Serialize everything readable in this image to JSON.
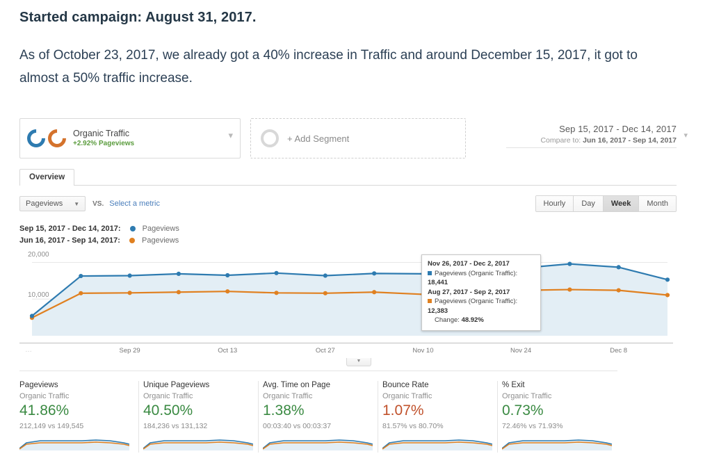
{
  "article": {
    "heading": "Started campaign: August 31, 2017.",
    "body": "As of October 23, 2017, we already got a 40% increase in Traffic and around December 15, 2017, it got to almost a 50% traffic increase."
  },
  "segment": {
    "name": "Organic Traffic",
    "delta": "+2.92% Pageviews",
    "caret": "chevron-down-icon",
    "add_label": "+ Add Segment"
  },
  "date_picker": {
    "range": "Sep 15, 2017 - Dec 14, 2017",
    "compare_prefix": "Compare to:",
    "compare_range": "Jun 16, 2017 - Sep 14, 2017"
  },
  "tabs": [
    {
      "label": "Overview",
      "active": true
    }
  ],
  "metric_bar": {
    "selected_metric": "Pageviews",
    "vs_label": "VS.",
    "select_metric_link": "Select a metric",
    "granularity": [
      {
        "label": "Hourly",
        "active": false
      },
      {
        "label": "Day",
        "active": false
      },
      {
        "label": "Week",
        "active": true
      },
      {
        "label": "Month",
        "active": false
      }
    ]
  },
  "legend": [
    {
      "range": "Sep 15, 2017 - Dec 14, 2017:",
      "series": "Pageviews",
      "color": "#2e7bb0"
    },
    {
      "range": "Jun 16, 2017 - Sep 14, 2017:",
      "series": "Pageviews",
      "color": "#e08020"
    }
  ],
  "tooltip": {
    "period1_range": "Nov 26, 2017 - Dec 2, 2017",
    "period1_metric": "Pageviews (Organic Traffic):",
    "period1_value": "18,441",
    "period2_range": "Aug 27, 2017 - Sep 2, 2017",
    "period2_metric": "Pageviews (Organic Traffic):",
    "period2_value": "12,383",
    "change_label": "Change:",
    "change_value": "48.92%"
  },
  "chart_data": {
    "type": "line",
    "title": "Pageviews (Organic Traffic)",
    "xlabel": "",
    "ylabel": "Pageviews",
    "ylim": [
      0,
      22000
    ],
    "yticks": [
      10000,
      20000
    ],
    "ytick_labels": [
      "10,000",
      "20,000"
    ],
    "grid": true,
    "legend_position": "above-left",
    "x": [
      "Sep 15",
      "Sep 22",
      "Sep 29",
      "Oct 6",
      "Oct 13",
      "Oct 20",
      "Oct 27",
      "Nov 3",
      "Nov 10",
      "Nov 17",
      "Nov 24",
      "Dec 1",
      "Dec 8",
      "Dec 14"
    ],
    "xtick_labels": [
      "Sep 29",
      "Oct 13",
      "Oct 27",
      "Nov 10",
      "Nov 24",
      "Dec 8"
    ],
    "series": [
      {
        "name": "Pageviews",
        "period": "Sep 15, 2017 - Dec 14, 2017",
        "color": "#2e7bb0",
        "fill": "#e3eef5",
        "values": [
          5400,
          16300,
          16400,
          16900,
          16500,
          17100,
          16400,
          17000,
          16900,
          18300,
          18441,
          19600,
          18700,
          15300
        ]
      },
      {
        "name": "Pageviews",
        "period": "Jun 16, 2017 - Sep 14, 2017",
        "color": "#e08020",
        "values": [
          4900,
          11600,
          11700,
          11900,
          12100,
          11700,
          11600,
          11900,
          11300,
          11400,
          12383,
          12600,
          12400,
          11100
        ]
      }
    ]
  },
  "cards": [
    {
      "title": "Pageviews",
      "segment": "Organic Traffic",
      "change": "41.86%",
      "positive": true,
      "comparison": "212,149 vs 149,545"
    },
    {
      "title": "Unique Pageviews",
      "segment": "Organic Traffic",
      "change": "40.50%",
      "positive": true,
      "comparison": "184,236 vs 131,132"
    },
    {
      "title": "Avg. Time on Page",
      "segment": "Organic Traffic",
      "change": "1.38%",
      "positive": true,
      "comparison": "00:03:40 vs 00:03:37"
    },
    {
      "title": "Bounce Rate",
      "segment": "Organic Traffic",
      "change": "1.07%",
      "positive": false,
      "comparison": "81.57% vs 80.70%"
    },
    {
      "title": "% Exit",
      "segment": "Organic Traffic",
      "change": "0.73%",
      "positive": true,
      "comparison": "72.46% vs 71.93%"
    }
  ],
  "colors": {
    "current_series": "#2e7bb0",
    "previous_series": "#e08020",
    "positive": "#3a8a42",
    "negative": "#c0512b",
    "area_fill": "#e3eef5"
  }
}
